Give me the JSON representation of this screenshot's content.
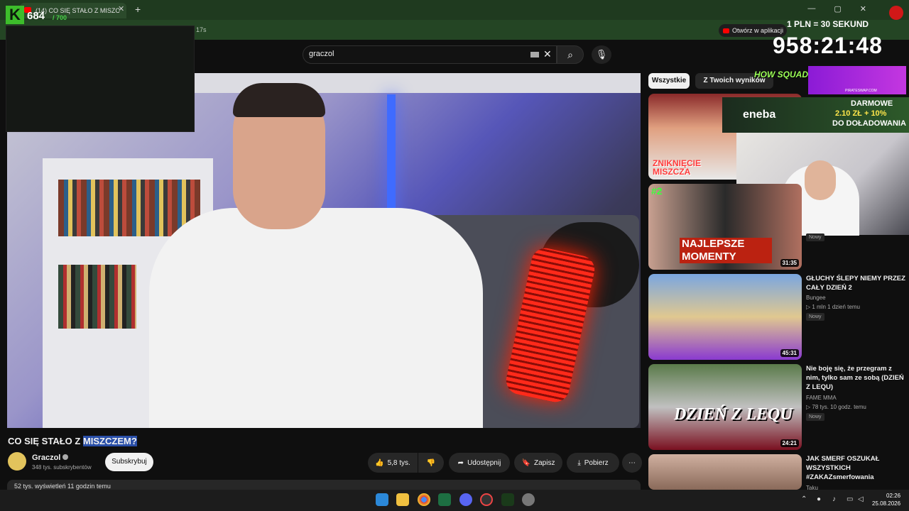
{
  "browser": {
    "tab_title": "(14) CO SIĘ STAŁO Z MISZC",
    "url_fragment": "17s",
    "open_in_app": "Otwórz w aplikacji",
    "new_tab": "+",
    "tab_close": "✕",
    "window_controls": [
      "—",
      "▢",
      "✕"
    ]
  },
  "stream_overlay": {
    "counter": "684",
    "counter_total": "/ 700",
    "timer_label": "1 PLN = 30 SEKUND",
    "timer": "958:21:48"
  },
  "youtube": {
    "search_value": "graczol",
    "video": {
      "title_plain": "CO SIĘ STAŁO Z ",
      "title_highlight": "MISZCZEM?",
      "channel": "Graczol",
      "subscribers": "348 tys. subskrybentów",
      "subscribe_label": "Subskrybuj",
      "likes": "5,8 tys.",
      "share_label": "Udostępnij",
      "save_label": "Zapisz",
      "download_label": "Pobierz",
      "views_line": "52 tys. wyświetleń  11 godzin temu"
    },
    "chips": [
      "Wszystkie",
      "Z Twoich wyników"
    ],
    "recommended": [
      {
        "duration": "",
        "thumb_text": "ZNIKNIĘCIE MISZCZA"
      },
      {
        "duration": "31:35",
        "thumb_text": "NAJLEPSZE MOMENTY",
        "thumb_badge": "#2",
        "badge": "Nowy"
      },
      {
        "title": "GŁUCHY ŚLEPY NIEMY PRZEZ CAŁY DZIEŃ 2",
        "channel": "Bungee",
        "meta": "▷ 1 mln  1 dzień temu",
        "badge": "Nowy",
        "duration": "45:31"
      },
      {
        "title": "Nie boję się, że przegram z nim, tylko sam ze sobą (DZIEŃ Z LEQU)",
        "channel": "FAME MMA",
        "meta": "▷ 78 tys.  10 godz. temu",
        "badge": "Nowy",
        "duration": "24:21",
        "thumb_text": "DZIEŃ Z LEQU"
      },
      {
        "title": "JAK SMERF OSZUKAŁ WSZYSTKICH #ZAKAZsmerfowania",
        "channel": "Taku"
      }
    ]
  },
  "ads": {
    "how_squad": "HOW SQUAD",
    "pirate_url": "PIRATESWAP.COM",
    "eneba_logo": "eneba",
    "eneba_line1": "DARMOWE",
    "eneba_line2": "2.10 ZŁ + 10%",
    "eneba_line3": "DO DOŁADOWANIA"
  },
  "taskbar": {
    "time": "02:26",
    "date": "25.08.2026"
  },
  "colors": {
    "accent_red": "#ff0000",
    "chrome_green": "#1f3a1f",
    "yt_bg": "#0f0f0f"
  }
}
